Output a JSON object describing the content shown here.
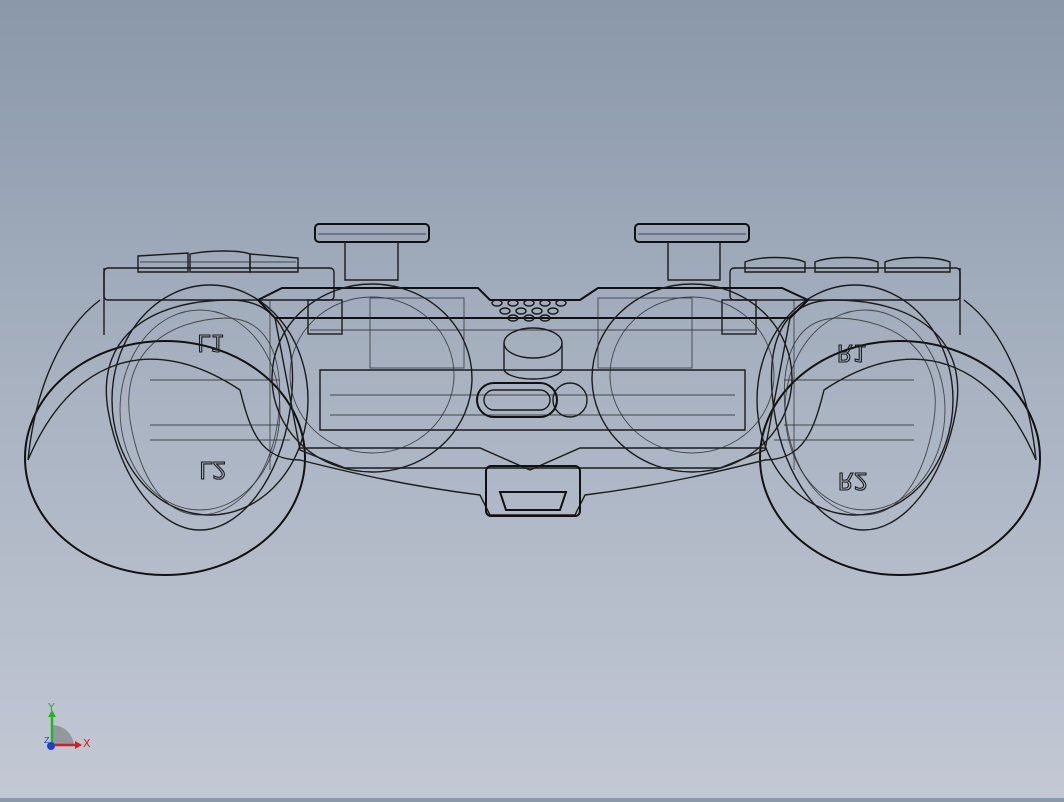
{
  "view": {
    "background_top": "#8a98aa",
    "background_bottom": "#c3c8d4",
    "line_color": "#1b1b1b"
  },
  "model": {
    "labels": {
      "l1": "L1",
      "l2": "L2",
      "r1": "R1",
      "r2": "R2"
    }
  },
  "triad": {
    "x_label": "X",
    "y_label": "Y",
    "z_label": "Z",
    "x_color": "#d81e1e",
    "y_color": "#1fb81f",
    "z_color": "#1d3fd0"
  }
}
